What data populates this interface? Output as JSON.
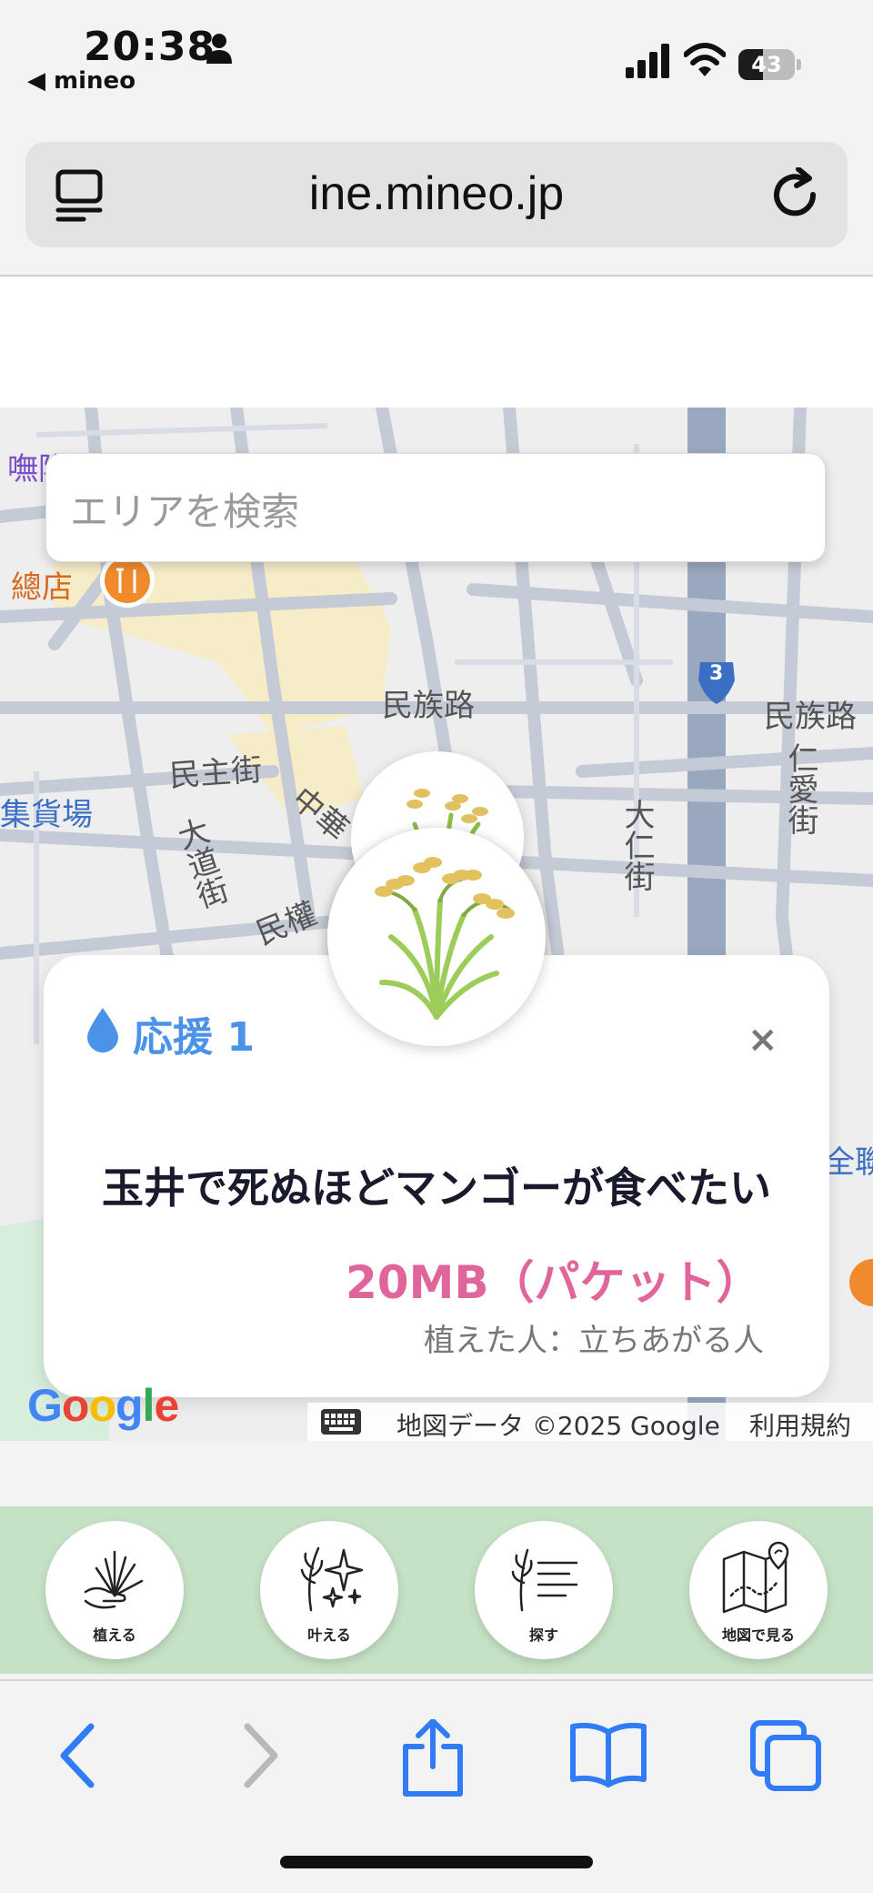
{
  "status_bar": {
    "time": "20:38",
    "carrier_back": "◀ mineo",
    "battery_level": "43",
    "icons": [
      "person-icon",
      "signal-icon",
      "wifi-icon",
      "battery-icon"
    ]
  },
  "url_bar": {
    "url": "ine.mineo.jp",
    "left_icon": "reader-icon",
    "right_icon": "reload-icon"
  },
  "map": {
    "search_placeholder": "エリアを検索",
    "labels": {
      "top_left": "嘸隐",
      "store": "總店",
      "minzu_road_1": "民族路",
      "minzu_road_2": "民族路",
      "minzhu_street": "民主街",
      "jihuo": "集貨場",
      "zhonghua": "中華",
      "dadao": "大道街",
      "minquan": "民權",
      "daren": "大仁街",
      "renai": "仁愛街",
      "route": "3",
      "right_edge": "全聯"
    },
    "google_logo": "Google",
    "attribution": "地図データ ©2025 Google",
    "terms": "利用規約"
  },
  "card": {
    "support_label": "応援 1",
    "close_label": "×",
    "title": "玉井で死ぬほどマンゴーが食べたい",
    "amount": "20MB（パケット）",
    "planter": "植えた人：立ちあがる人"
  },
  "bottom_nav": [
    {
      "label": "植える",
      "icon": "plant-hand-icon"
    },
    {
      "label": "叶える",
      "icon": "sparkle-rice-icon"
    },
    {
      "label": "探す",
      "icon": "search-list-icon"
    },
    {
      "label": "地図で見る",
      "icon": "map-pin-icon"
    }
  ],
  "toolbar": {
    "icons": [
      "back-icon",
      "forward-icon",
      "share-icon",
      "bookmarks-icon",
      "tabs-icon"
    ]
  },
  "colors": {
    "accent_blue": "#4b93e8",
    "amount_pink": "#e0659a",
    "nav_green": "#c6e2c6"
  }
}
